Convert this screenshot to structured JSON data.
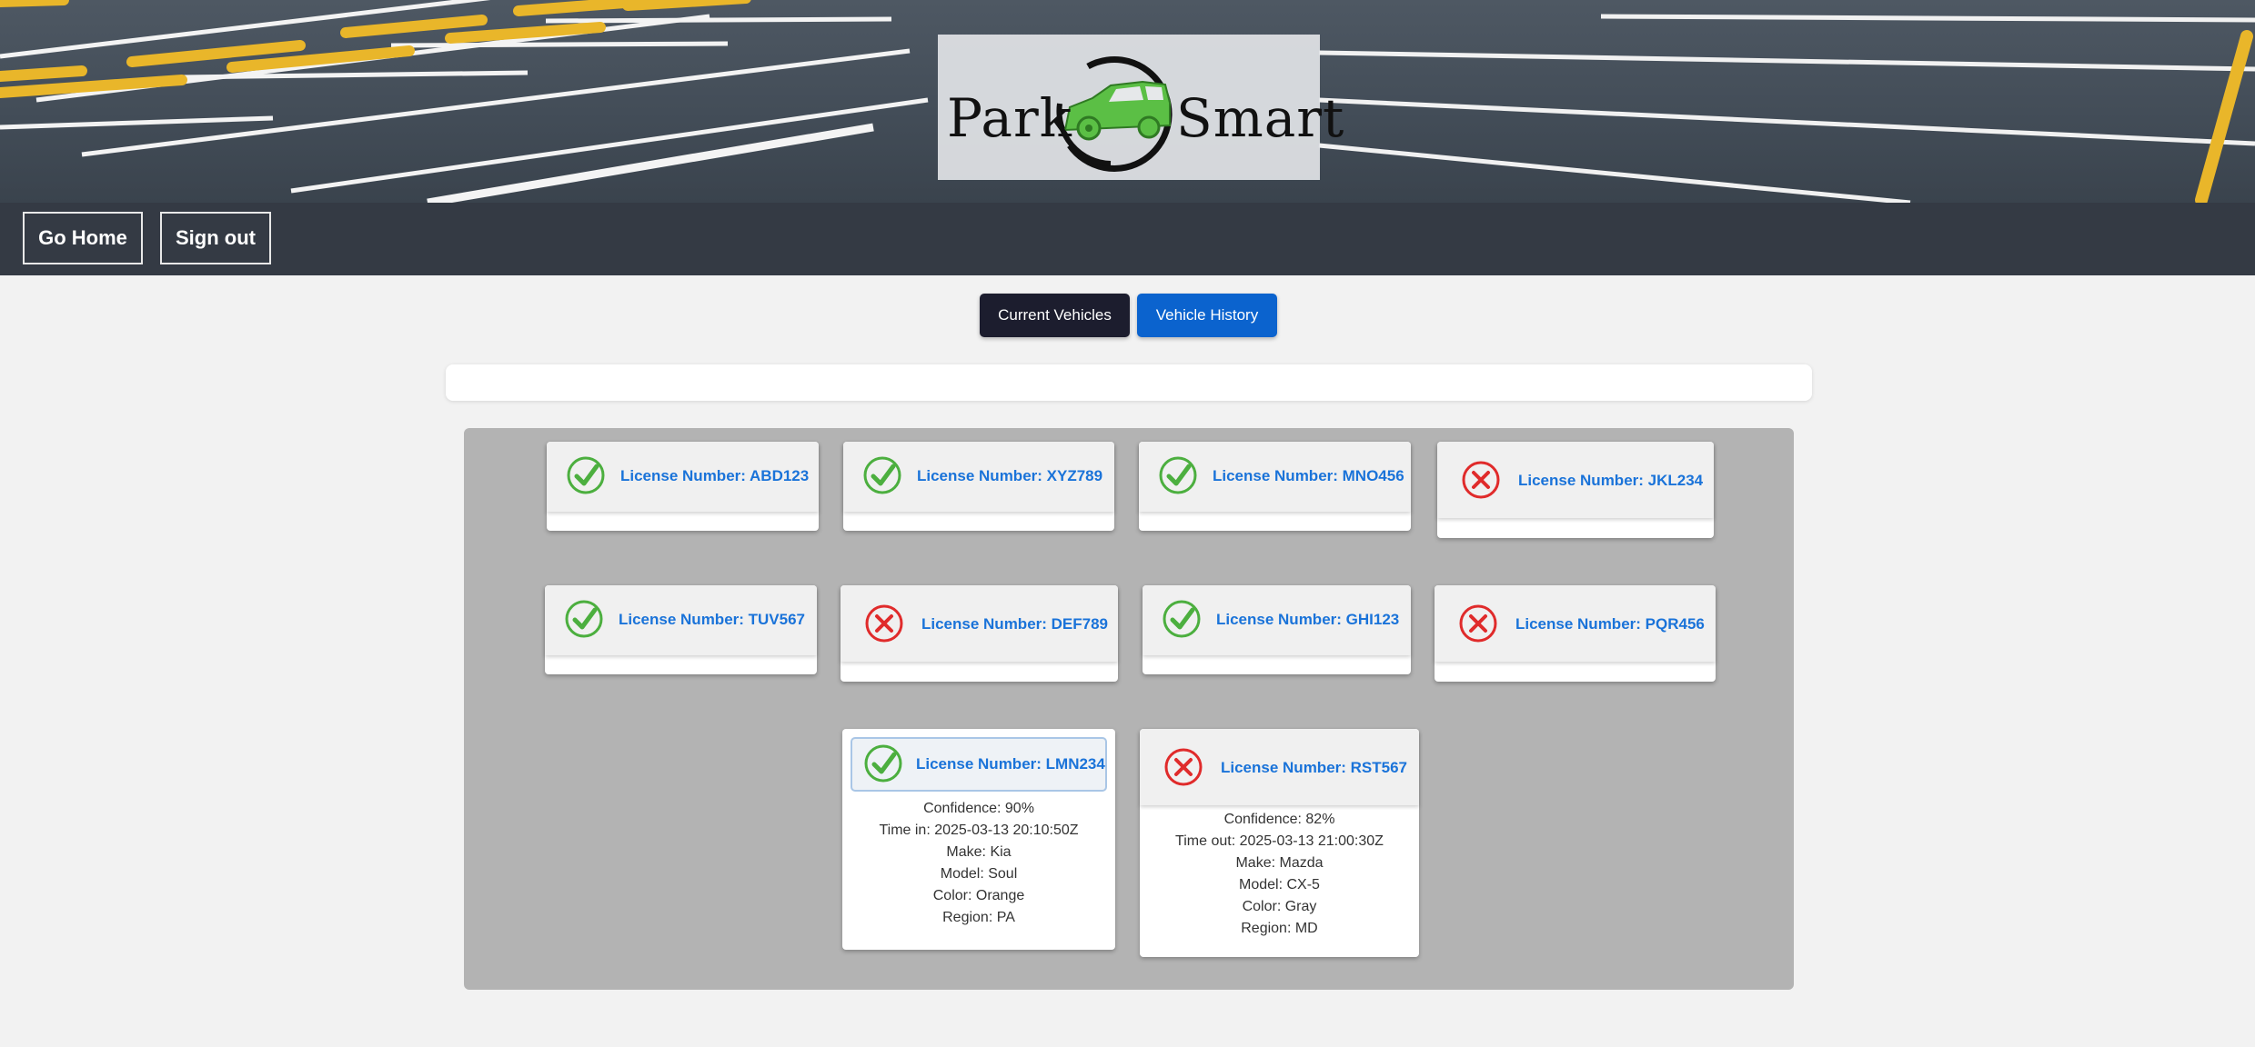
{
  "header": {
    "logo_left": "Park",
    "logo_right": "Smart"
  },
  "nav": {
    "home_label": "Go Home",
    "signout_label": "Sign out"
  },
  "tabs": [
    {
      "label": "Current Vehicles",
      "active": true
    },
    {
      "label": "Vehicle History",
      "active": false
    }
  ],
  "colors": {
    "ok": "#4caf3f",
    "fail": "#e02b2b",
    "plate": "#1a73d9",
    "tab_current": "#1c1d2e",
    "tab_history": "#0b63ce"
  },
  "vehicles": [
    {
      "plate": "License Number: ABD123",
      "status": "check-icon"
    },
    {
      "plate": "License Number: XYZ789",
      "status": "check-icon"
    },
    {
      "plate": "License Number: MNO456",
      "status": "check-icon"
    },
    {
      "plate": "License Number: JKL234",
      "status": "x-icon"
    },
    {
      "plate": "License Number: TUV567",
      "status": "check-icon"
    },
    {
      "plate": "License Number: DEF789",
      "status": "x-icon"
    },
    {
      "plate": "License Number: GHI123",
      "status": "check-icon"
    },
    {
      "plate": "License Number: PQR456",
      "status": "x-icon"
    },
    {
      "plate": "License Number: LMN234",
      "status": "check-icon",
      "details": [
        "Confidence: 90%",
        "Time in: 2025-03-13 20:10:50Z",
        "Make: Kia",
        "Model: Soul",
        "Color: Orange",
        "Region: PA"
      ]
    },
    {
      "plate": "License Number: RST567",
      "status": "x-icon",
      "details": [
        "Confidence: 82%",
        "Time out: 2025-03-13 21:00:30Z",
        "Make: Mazda",
        "Model: CX-5",
        "Color: Gray",
        "Region: MD"
      ]
    }
  ]
}
